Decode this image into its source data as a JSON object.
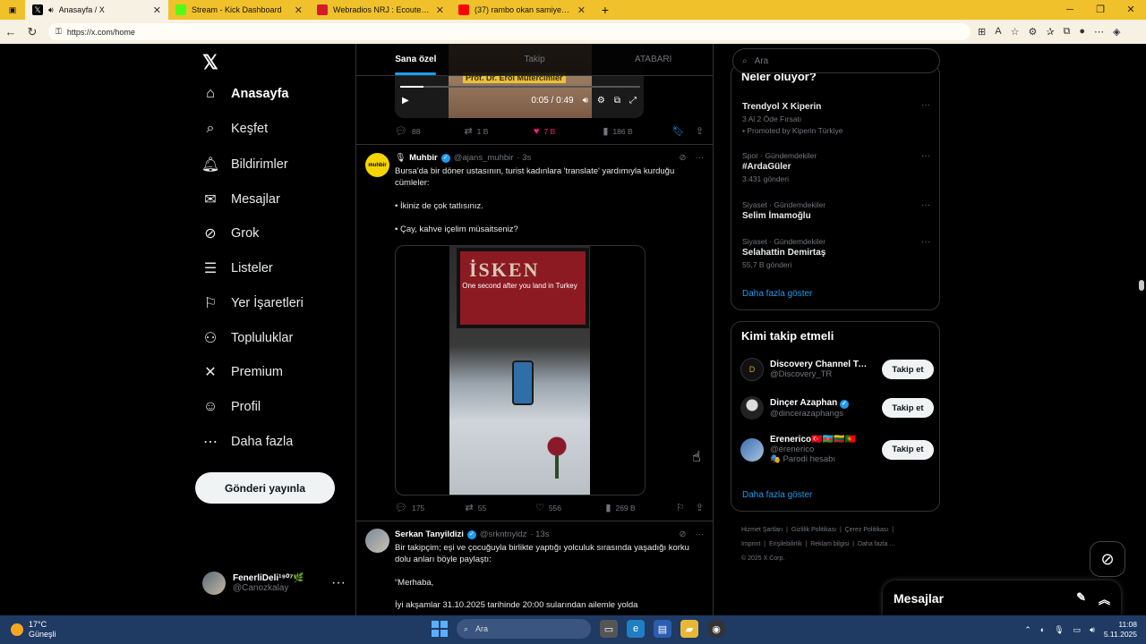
{
  "browser": {
    "tabs": [
      {
        "title": "Anasayfa / X",
        "active": true,
        "favicon_color": "#000000"
      },
      {
        "title": "Stream - Kick Dashboard",
        "active": false,
        "favicon_color": "#53fc18"
      },
      {
        "title": "Webradios NRJ : Ecoute en direct",
        "active": false,
        "favicon_color": "#d61b2b"
      },
      {
        "title": "(37) rambo okan samiyen anısı - YouTube",
        "active": false,
        "favicon_color": "#ff0000"
      }
    ],
    "new_tab": "+",
    "url": "https://x.com/home"
  },
  "leftnav": {
    "logo": "𝕏",
    "items": [
      {
        "label": "Anasayfa",
        "icon": "home-icon",
        "glyph": "⌂"
      },
      {
        "label": "Keşfet",
        "icon": "search-icon",
        "glyph": "⌕"
      },
      {
        "label": "Bildirimler",
        "icon": "bell-icon",
        "glyph": "🔔︎"
      },
      {
        "label": "Mesajlar",
        "icon": "mail-icon",
        "glyph": "✉"
      },
      {
        "label": "Grok",
        "icon": "grok-icon",
        "glyph": "⊘"
      },
      {
        "label": "Listeler",
        "icon": "list-icon",
        "glyph": "☰"
      },
      {
        "label": "Yer İşaretleri",
        "icon": "bookmark-icon",
        "glyph": "⚐"
      },
      {
        "label": "Topluluklar",
        "icon": "communities-icon",
        "glyph": "⚇"
      },
      {
        "label": "Premium",
        "icon": "x-premium-icon",
        "glyph": "✕"
      },
      {
        "label": "Profil",
        "icon": "profile-icon",
        "glyph": "☺"
      },
      {
        "label": "Daha fazla",
        "icon": "more-circle-icon",
        "glyph": "⋯"
      }
    ],
    "post_button": "Gönderi yayınla",
    "profile": {
      "name": "FenerliDeli¹⁹⁰⁷🌿",
      "handle": "@Canozkalay",
      "more": "···"
    }
  },
  "center": {
    "tabs": [
      "Sana özel",
      "Takip",
      "ATABARI"
    ],
    "prev_post": {
      "video_caption": "Prof. Dr. Erol Mütercimler",
      "time": "0:05 / 0:49",
      "actions": {
        "replies": "88",
        "reposts": "1 B",
        "likes": "7 B",
        "views": "186 B"
      }
    },
    "post1": {
      "name": "Muhbir",
      "handle": "@ajans_muhbir",
      "time": "· 3s",
      "avatar_text": "muhbir",
      "lines": [
        "Bursa'da bir döner ustasının, turist kadınlara 'translate' yardımıyla kurduğu cümleler:",
        "• İkiniz de çok tatlısınız.",
        "• Çay, kahve içelim müsaitseniz?"
      ],
      "media_overlay": "One second after you land in Turkey",
      "media_sign": "İSKEN",
      "actions": {
        "replies": "175",
        "reposts": "55",
        "likes": "556",
        "views": "269 B"
      }
    },
    "post2": {
      "name": "Serkan Tanyildizi",
      "handle": "@srkntnyldz",
      "time": "· 13s",
      "lines": [
        "Bir takipçim; eşi ve çocuğuyla birlikte yaptığı yolculuk sırasında yaşadığı korku dolu anları böyle paylaştı:",
        "“Merhaba,",
        "İyi akşamlar 31.10.2025 tarihinde 20:00 sularından ailemle yolda"
      ]
    }
  },
  "right": {
    "search_placeholder": "Ara",
    "trends_title": "Neler oluyor?",
    "trends": [
      {
        "meta": "",
        "title": "Trendyol X Kiperin",
        "count": "3 Al 2 Öde Fırsatı",
        "promoted": "Promoted by Kiperin Türkiye"
      },
      {
        "meta": "Spor · Gündemdekiler",
        "title": "#ArdaGüler",
        "count": "3.431 gönderi"
      },
      {
        "meta": "Siyaset · Gündemdekiler",
        "title": "Selim İmamoğlu",
        "count": ""
      },
      {
        "meta": "Siyaset · Gündemdekiler",
        "title": "Selahattin Demirtaş",
        "count": "55,7 B gönderi"
      }
    ],
    "trends_more": "Daha fazla göster",
    "who_title": "Kimi takip etmeli",
    "who": [
      {
        "name": "Discovery Channel Tu...",
        "handle": "@Discovery_TR",
        "extra": "",
        "button": "Takip et"
      },
      {
        "name": "Dinçer Azaphan",
        "handle": "@dincerazaphangs",
        "extra": "",
        "button": "Takip et"
      },
      {
        "name": "Erenerico🇹🇷🇦🇿🇱🇹🇵🇹",
        "handle": "@erenerico",
        "extra": "🎭 Parodi hesabı",
        "button": "Takip et"
      }
    ],
    "who_more": "Daha fazla göster",
    "footer": [
      "Hizmet Şartları",
      "Gizlilik Politikası",
      "Çerez Politikası",
      "Imprint",
      "Erişilebilirlik",
      "Reklam bilgisi",
      "Daha fazla ...",
      "© 2025 X Corp."
    ],
    "messages": "Mesajlar"
  },
  "taskbar": {
    "temp": "17°C",
    "weather": "Güneşli",
    "search": "Ara",
    "time": "11:08",
    "date": "5.11.2025",
    "badge": "8"
  }
}
